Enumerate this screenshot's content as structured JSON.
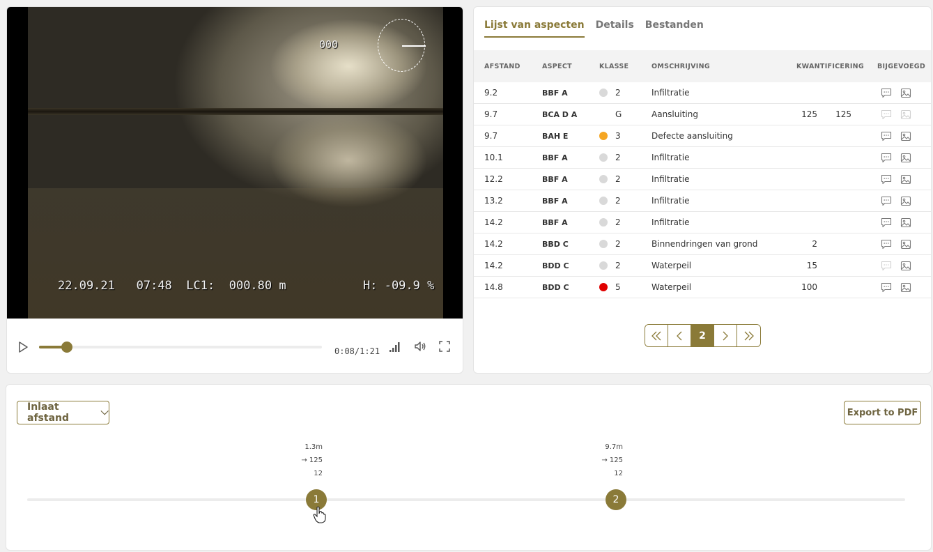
{
  "video": {
    "osd_counter": "000",
    "osd_date": "22.09.21",
    "osd_time": "07:48",
    "osd_lc_label": "LC1:",
    "osd_lc_value": "000.80 m",
    "osd_h": "H: -09.9 %",
    "current_time": "0:08",
    "separator": "/",
    "duration": "1:21",
    "progress_fraction": 0.099
  },
  "tabs": [
    {
      "label": "Lijst van aspecten",
      "active": true
    },
    {
      "label": "Details",
      "active": false
    },
    {
      "label": "Bestanden",
      "active": false
    }
  ],
  "table": {
    "headers": [
      "AFSTAND",
      "ASPECT",
      "KLASSE",
      "OMSCHRIJVING",
      "KWANTIFICERING",
      "BIJGEVOEGD"
    ],
    "rows": [
      {
        "afstand": "9.2",
        "aspect": "BBF A",
        "klasse": "2",
        "dot": "#d9d9d9",
        "omschrijving": "Infiltratie",
        "q1": "",
        "q2": "",
        "comment_active": true,
        "image_active": true
      },
      {
        "afstand": "9.7",
        "aspect": "BCA D A",
        "klasse": "G",
        "dot": "",
        "omschrijving": "Aansluiting",
        "q1": "125",
        "q2": "125",
        "comment_active": false,
        "image_active": false
      },
      {
        "afstand": "9.7",
        "aspect": "BAH E",
        "klasse": "3",
        "dot": "#f5a623",
        "omschrijving": "Defecte aansluiting",
        "q1": "",
        "q2": "",
        "comment_active": true,
        "image_active": true
      },
      {
        "afstand": "10.1",
        "aspect": "BBF A",
        "klasse": "2",
        "dot": "#d9d9d9",
        "omschrijving": "Infiltratie",
        "q1": "",
        "q2": "",
        "comment_active": true,
        "image_active": true
      },
      {
        "afstand": "12.2",
        "aspect": "BBF A",
        "klasse": "2",
        "dot": "#d9d9d9",
        "omschrijving": "Infiltratie",
        "q1": "",
        "q2": "",
        "comment_active": true,
        "image_active": true
      },
      {
        "afstand": "13.2",
        "aspect": "BBF A",
        "klasse": "2",
        "dot": "#d9d9d9",
        "omschrijving": "Infiltratie",
        "q1": "",
        "q2": "",
        "comment_active": true,
        "image_active": true
      },
      {
        "afstand": "14.2",
        "aspect": "BBF A",
        "klasse": "2",
        "dot": "#d9d9d9",
        "omschrijving": "Infiltratie",
        "q1": "",
        "q2": "",
        "comment_active": true,
        "image_active": true
      },
      {
        "afstand": "14.2",
        "aspect": "BBD C",
        "klasse": "2",
        "dot": "#d9d9d9",
        "omschrijving": "Binnendringen van grond",
        "q1": "2",
        "q2": "",
        "comment_active": true,
        "image_active": true
      },
      {
        "afstand": "14.2",
        "aspect": "BDD C",
        "klasse": "2",
        "dot": "#d9d9d9",
        "omschrijving": "Waterpeil",
        "q1": "15",
        "q2": "",
        "comment_active": false,
        "image_active": true
      },
      {
        "afstand": "14.8",
        "aspect": "BDD C",
        "klasse": "5",
        "dot": "#e00000",
        "omschrijving": "Waterpeil",
        "q1": "100",
        "q2": "",
        "comment_active": true,
        "image_active": true
      }
    ]
  },
  "pagination": {
    "current_page": "2"
  },
  "timeline": {
    "dropdown_label": "Inlaat afstand",
    "export_label": "Export to PDF",
    "markers": [
      {
        "number": "1",
        "distance": "1.3m",
        "direction": "125",
        "value": "12"
      },
      {
        "number": "2",
        "distance": "9.7m",
        "direction": "125",
        "value": "12"
      }
    ]
  },
  "colors": {
    "accent": "#8a7a38"
  }
}
